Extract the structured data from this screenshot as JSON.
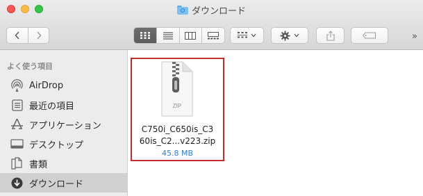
{
  "window": {
    "title": "ダウンロード"
  },
  "toolbar": {
    "back_icon": "chevron-left-icon",
    "forward_icon": "chevron-right-icon",
    "view_icons": [
      "icon-view-icon",
      "list-view-icon",
      "column-view-icon",
      "gallery-view-icon"
    ],
    "active_view": "icon-view",
    "group_icon": "group-by-icon",
    "action_icon": "gear-icon",
    "share_icon": "share-icon",
    "tag_icon": "tag-icon",
    "more_label": "»"
  },
  "sidebar": {
    "heading": "よく使う項目",
    "items": [
      {
        "label": "AirDrop",
        "icon": "airdrop-icon"
      },
      {
        "label": "最近の項目",
        "icon": "recents-icon"
      },
      {
        "label": "アプリケーション",
        "icon": "applications-icon"
      },
      {
        "label": "デスクトップ",
        "icon": "desktop-icon"
      },
      {
        "label": "書類",
        "icon": "documents-icon"
      },
      {
        "label": "ダウンロード",
        "icon": "downloads-icon",
        "selected": true
      }
    ]
  },
  "files": [
    {
      "type_label": "ZIP",
      "name_line1": "C750i_C650is_C3",
      "name_line2": "60is_C2...v223.zip",
      "size": "45.8 MB",
      "highlighted": true
    }
  ],
  "colors": {
    "highlight_border": "#c02b2b",
    "size_text": "#2f7fd8",
    "sidebar_selected": "#d0d0d0"
  }
}
